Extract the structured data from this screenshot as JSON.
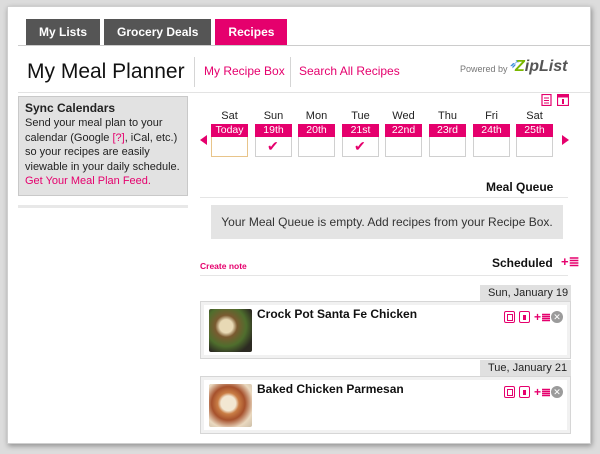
{
  "tabs": [
    {
      "label": "My Lists",
      "active": false
    },
    {
      "label": "Grocery Deals",
      "active": false
    },
    {
      "label": "Recipes",
      "active": true
    }
  ],
  "header": {
    "title": "My Meal Planner",
    "links": [
      "My Recipe Box",
      "Search All Recipes"
    ],
    "powered_by": "Powered by",
    "brand": "ZipList"
  },
  "sync": {
    "title": "Sync Calendars",
    "text_before": "Send your meal plan to your calendar (Google ",
    "help": "[?]",
    "text_after": ", iCal, etc.) so your recipes are easily viewable in your daily schedule.",
    "feed_link": "Get Your Meal Plan Feed."
  },
  "week": [
    {
      "dow": "Sat",
      "date": "Today",
      "checked": false,
      "today": true
    },
    {
      "dow": "Sun",
      "date": "19th",
      "checked": true
    },
    {
      "dow": "Mon",
      "date": "20th",
      "checked": false
    },
    {
      "dow": "Tue",
      "date": "21st",
      "checked": true
    },
    {
      "dow": "Wed",
      "date": "22nd",
      "checked": false
    },
    {
      "dow": "Thu",
      "date": "23rd",
      "checked": false
    },
    {
      "dow": "Fri",
      "date": "24th",
      "checked": false
    },
    {
      "dow": "Sat",
      "date": "25th",
      "checked": false
    }
  ],
  "queue": {
    "title": "Meal Queue",
    "empty_text": "Your Meal Queue is empty. Add recipes from your Recipe Box."
  },
  "scheduled": {
    "create_note": "Create note",
    "title": "Scheduled",
    "entries": [
      {
        "date": "Sun, January 19",
        "recipe": "Crock Pot Santa Fe Chicken"
      },
      {
        "date": "Tue, January 21",
        "recipe": "Baked Chicken Parmesan"
      }
    ]
  },
  "colors": {
    "accent": "#e5006d",
    "tab_dark": "#555555"
  }
}
